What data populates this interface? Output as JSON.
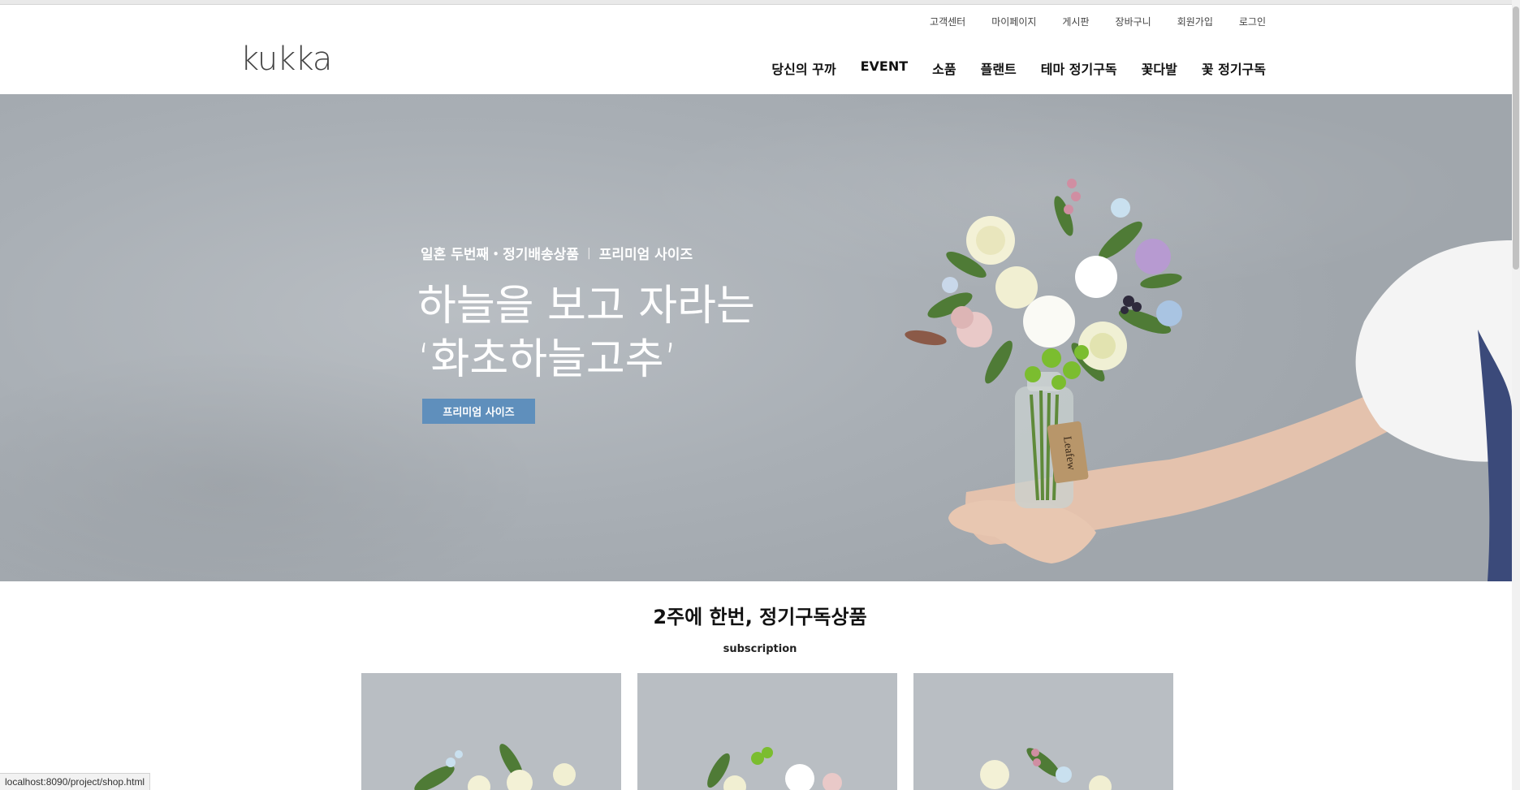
{
  "header": {
    "logo": "kukka",
    "util_nav": [
      "고객센터",
      "마이페이지",
      "게시판",
      "장바구니",
      "회원가입",
      "로그인"
    ],
    "main_nav": [
      "당신의 꾸까",
      "EVENT",
      "소품",
      "플랜트",
      "테마 정기구독",
      "꽃다발",
      "꽃 정기구독"
    ]
  },
  "hero": {
    "subtitle_left": "일혼 두번째・정기배송상품",
    "subtitle_sep": "|",
    "subtitle_right": "프리미엄 사이즈",
    "title_line1": "하늘을 보고 자라는",
    "title_line2": "‘화초하늘고추’",
    "button_label": "프리미엄 사이즈",
    "tag_text": "Leafew"
  },
  "section": {
    "title": "2주에 한번, 정기구독상품",
    "subtitle": "subscription"
  },
  "status_bar": {
    "url": "localhost:8090/project/shop.html"
  },
  "colors": {
    "accent_button": "#5f8fbc",
    "hero_bg": "#a9afb5"
  }
}
